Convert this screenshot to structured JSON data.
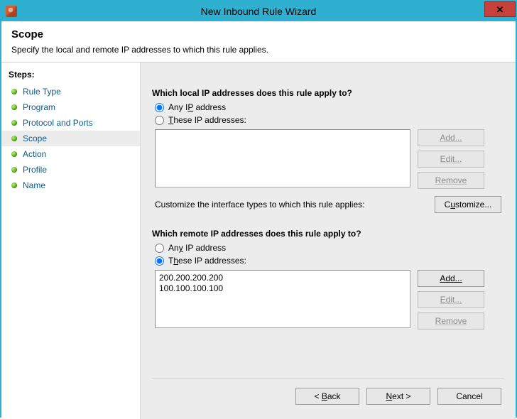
{
  "window": {
    "title": "New Inbound Rule Wizard",
    "close_glyph": "✕"
  },
  "header": {
    "title": "Scope",
    "subtitle": "Specify the local and remote IP addresses to which this rule applies."
  },
  "sidebar": {
    "label": "Steps:",
    "items": [
      {
        "label": "Rule Type",
        "current": false
      },
      {
        "label": "Program",
        "current": false
      },
      {
        "label": "Protocol and Ports",
        "current": false
      },
      {
        "label": "Scope",
        "current": true
      },
      {
        "label": "Action",
        "current": false
      },
      {
        "label": "Profile",
        "current": false
      },
      {
        "label": "Name",
        "current": false
      }
    ]
  },
  "scope": {
    "local": {
      "question": "Which local IP addresses does this rule apply to?",
      "any_prefix": "Any I",
      "any_u": "P",
      "any_suffix": " address",
      "these_prefix": "",
      "these_u": "T",
      "these_suffix": "hese IP addresses:",
      "selected": "any",
      "addresses": []
    },
    "customize": {
      "text": "Customize the interface types to which this rule applies:",
      "button_prefix": "C",
      "button_u": "u",
      "button_suffix": "stomize..."
    },
    "remote": {
      "question": "Which remote IP addresses does this rule apply to?",
      "any_prefix": "An",
      "any_u": "y",
      "any_suffix": " IP address",
      "these_prefix": "T",
      "these_u": "h",
      "these_suffix": "ese IP addresses:",
      "selected": "these",
      "addresses": [
        "200.200.200.200",
        "100.100.100.100"
      ]
    },
    "buttons": {
      "add": "Add...",
      "edit": "Edit...",
      "remove": "Remove"
    }
  },
  "footer": {
    "back_prefix": "< ",
    "back_u": "B",
    "back_suffix": "ack",
    "next_prefix": "",
    "next_u": "N",
    "next_suffix": "ext >",
    "cancel": "Cancel"
  }
}
